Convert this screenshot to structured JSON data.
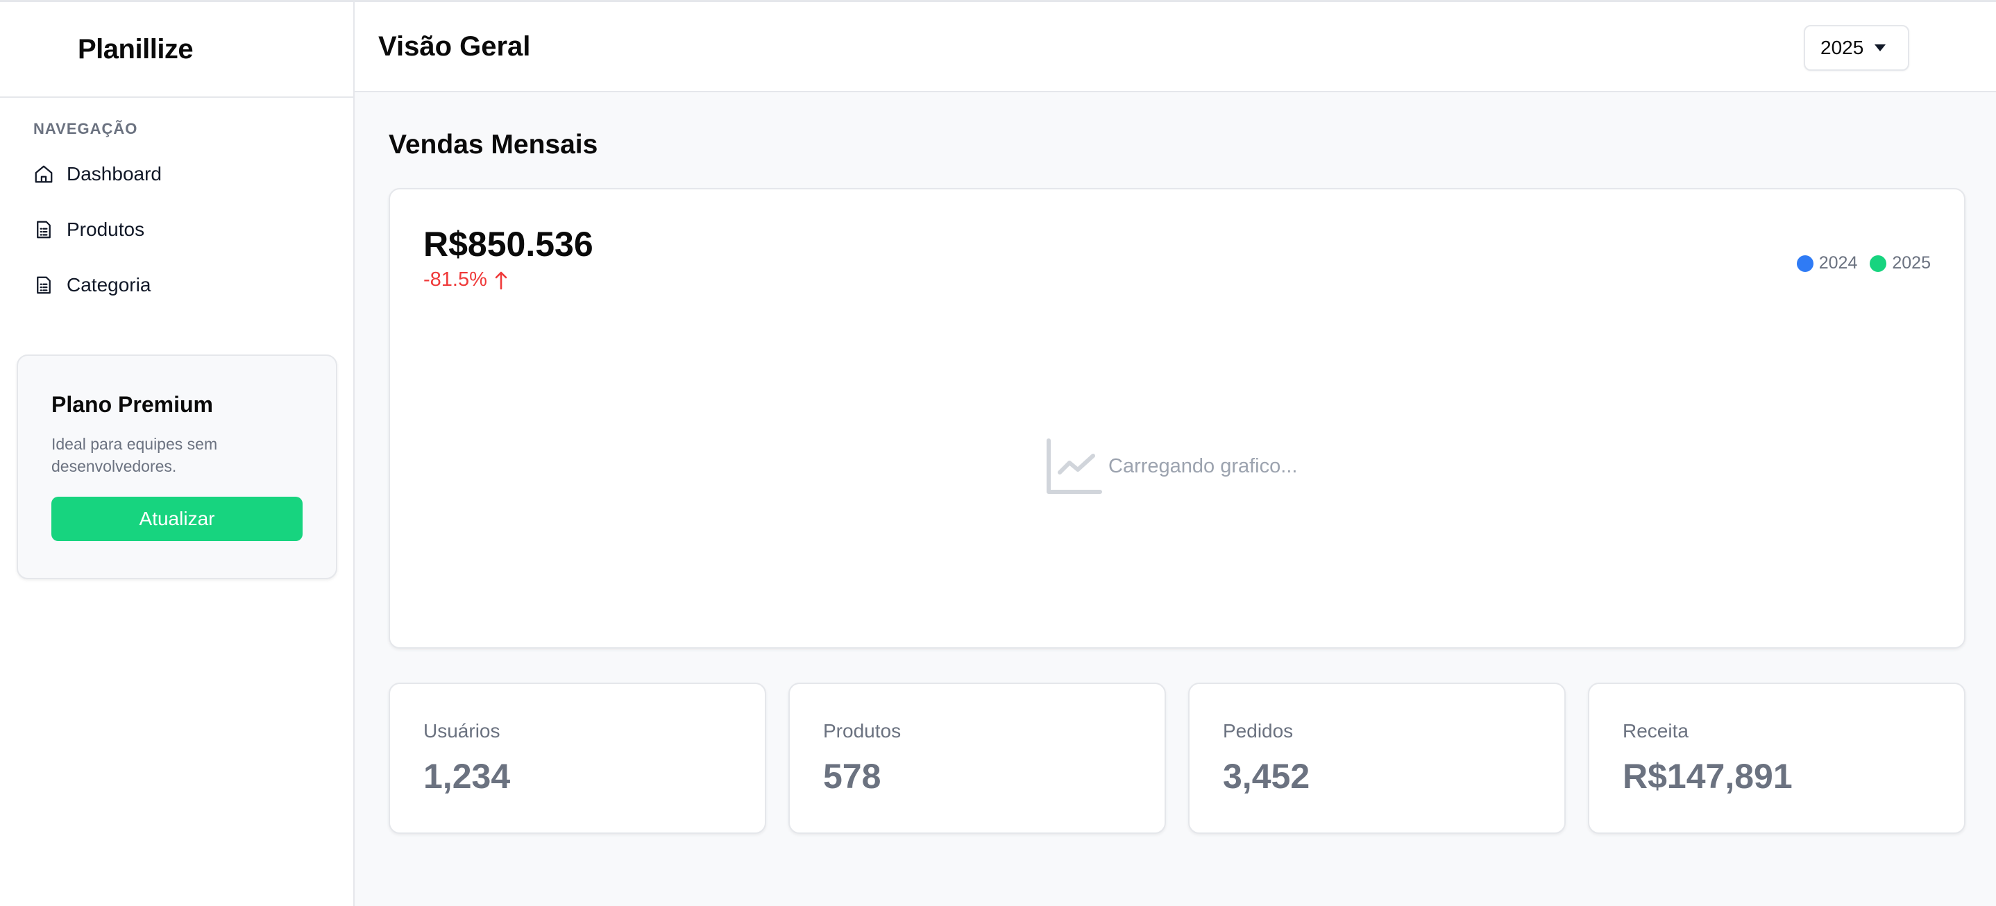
{
  "sidebar": {
    "brand": "Planillize",
    "nav_heading": "NAVEGAÇÃO",
    "items": [
      {
        "label": "Dashboard",
        "icon": "home-icon"
      },
      {
        "label": "Produtos",
        "icon": "document-list-icon"
      },
      {
        "label": "Categoria",
        "icon": "document-list-icon"
      }
    ],
    "premium": {
      "title": "Plano Premium",
      "description": "Ideal para equipes sem desenvolvedores.",
      "button_label": "Atualizar"
    }
  },
  "header": {
    "title": "Visão Geral",
    "year_select": {
      "selected": "2025"
    }
  },
  "sales": {
    "section_title": "Vendas Mensais",
    "total": "R$850.536",
    "change": "-81.5%",
    "change_icon": "arrow-up-icon",
    "legend": [
      {
        "label": "2024",
        "color": "#2f7bf5"
      },
      {
        "label": "2025",
        "color": "#17d47f"
      }
    ],
    "loading_text": "Carregando grafico...",
    "loading_icon": "line-chart-icon"
  },
  "stats": [
    {
      "label": "Usuários",
      "value": "1,234"
    },
    {
      "label": "Produtos",
      "value": "578"
    },
    {
      "label": "Pedidos",
      "value": "3,452"
    },
    {
      "label": "Receita",
      "value": "R$147,891"
    }
  ],
  "colors": {
    "accent": "#17d47f",
    "negative": "#ef3a3a",
    "muted_text": "#6b7280",
    "border": "#e5e7eb"
  }
}
